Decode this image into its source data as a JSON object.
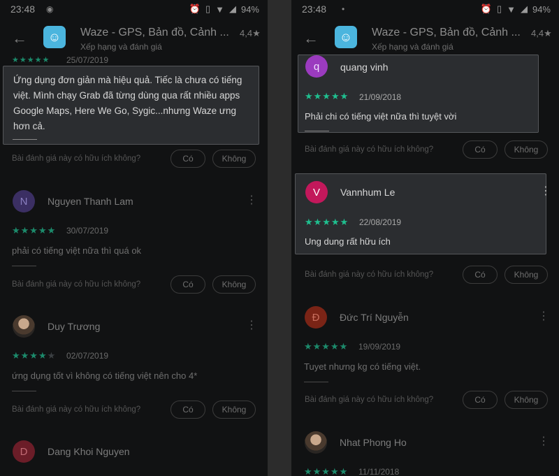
{
  "status": {
    "time": "23:48",
    "battery": "94%"
  },
  "app": {
    "title": "Waze - GPS, Bản đồ, Cảnh ...",
    "subtitle": "Xếp hạng và đánh giá",
    "rating": "4,4★"
  },
  "helpful": {
    "question": "Bài đánh giá này có hữu ích không?",
    "yes": "Có",
    "no": "Không"
  },
  "left": {
    "top_date": "25/07/2019",
    "popup_text": "Ứng dụng đơn giản mà hiệu quả. Tiếc là chưa có tiếng việt. Mình chạy Grab đã từng dùng qua rất nhiều apps Google Maps, Here We Go, Sygic...nhưng Waze ưng hơn cả.",
    "reviews": [
      {
        "initial": "N",
        "name": "Nguyen Thanh Lam",
        "date": "30/07/2019",
        "text": "phải có tiếng việt nữa thì quá ok",
        "stars": 5
      },
      {
        "name": "Duy Trương",
        "date": "02/07/2019",
        "text": "ứng dụng tốt vì không có tiếng việt nên cho 4*",
        "stars": 4
      },
      {
        "initial": "D",
        "name": "Dang Khoi Nguyen"
      }
    ]
  },
  "right": {
    "reviews": [
      {
        "initial": "q",
        "name": "quang vinh",
        "date": "21/09/2018",
        "text": "Phải chi có tiếng việt nữa thì tuyệt vời",
        "stars": 5
      },
      {
        "initial": "V",
        "name": "Vannhum Le",
        "date": "22/08/2019",
        "text": "Ung dung rất hữu ích",
        "stars": 5
      },
      {
        "initial": "Đ",
        "name": "Đức Trí Nguyễn",
        "date": "19/09/2019",
        "text": "Tuyet nhưng kg có tiếng việt.",
        "stars": 5
      },
      {
        "name": "Nhat Phong Ho",
        "date": "11/11/2018",
        "stars": 5
      }
    ]
  },
  "colors": {
    "star": "#1fbf8f",
    "avatar_n": "#3b2f63",
    "avatar_d": "#6b1d28",
    "avatar_q": "#9b3bbf",
    "avatar_v": "#c2185b",
    "avatar_dd": "#7a2416"
  }
}
